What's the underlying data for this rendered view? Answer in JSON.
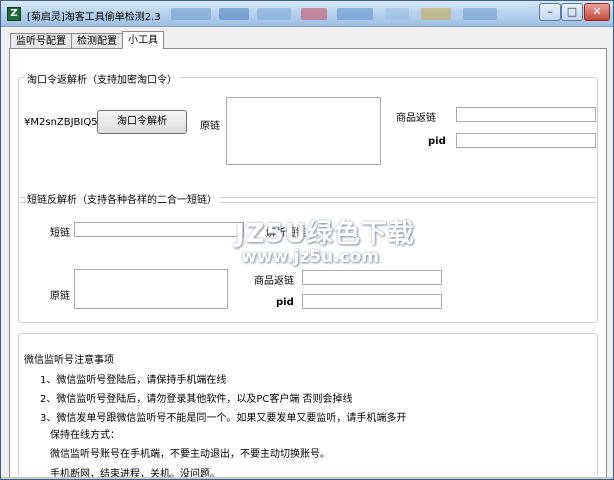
{
  "window": {
    "title": "[菊启灵]淘客工具偷单检测2.3",
    "controls": {
      "minimize": "–",
      "maximize": "□",
      "close": "✕"
    }
  },
  "tabs": [
    {
      "label": "监听号配置",
      "active": false
    },
    {
      "label": "检测配置",
      "active": false
    },
    {
      "label": "小工具",
      "active": true
    }
  ],
  "taokouling": {
    "group_title": "淘口令返解析（支持加密淘口令）",
    "code": "¥M2snZBJBIQ5¥",
    "parse_button": "淘口令解析",
    "original_label": "原链",
    "original_value": "",
    "product_link_label": "商品返链",
    "product_link_value": "",
    "pid_label": "pid",
    "pid_value": ""
  },
  "shortlink": {
    "group_title": "短链反解析（支持各种各样的二合一短链）",
    "short_label": "短链",
    "short_value": "",
    "parse_button": "解析短链",
    "original_label": "原链",
    "original_value": "",
    "product_link_label": "商品返链",
    "product_link_value": "",
    "pid_label": "pid",
    "pid_value": ""
  },
  "notes": {
    "title": "微信监听号注意事项",
    "lines": [
      "1、微信监听号登陆后，请保持手机端在线",
      "2、微信监听号登陆后，请勿登录其他软件，以及PC客户端    否则会掉线",
      "3、微信发单号跟微信监听号不能是同一个。如果又要发单又要监听，请手机端多开",
      "保持在线方式：",
      "微信监听号账号在手机端，不要主动退出，不要主动切换账号。",
      "手机断网，结束进程，关机。没问题。"
    ]
  },
  "watermark": {
    "main": "JZ5U绿色下载",
    "sub": "www.jz5u.com"
  },
  "colors": {
    "title_bar": "#b9d3ee",
    "close_button": "#c34a3c",
    "app_icon": "#1f6b3a"
  }
}
